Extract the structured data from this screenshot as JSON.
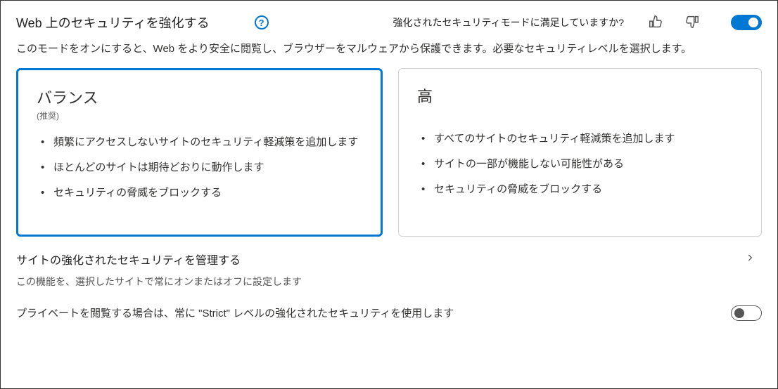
{
  "header": {
    "title": "Web 上のセキュリティを強化する",
    "help_icon_label": "?",
    "feedback_prompt": "強化されたセキュリティモードに満足していますか?",
    "main_toggle_on": true
  },
  "description": "このモードをオンにすると、Web をより安全に閲覧し、ブラウザーをマルウェアから保護できます。必要なセキュリティレベルを選択します。",
  "cards": {
    "balanced": {
      "title": "バランス",
      "subtitle": "(推奨)",
      "items": [
        "頻繁にアクセスしないサイトのセキュリティ軽減策を追加します",
        "ほとんどのサイトは期待どおりに動作します",
        "セキュリティの脅威をブロックする"
      ]
    },
    "strict": {
      "title": "高",
      "items": [
        "すべてのサイトのセキュリティ軽減策を追加します",
        "サイトの一部が機能しない可能性がある",
        "セキュリティの脅威をブロックする"
      ]
    }
  },
  "manage": {
    "title": "サイトの強化されたセキュリティを管理する",
    "desc": "この機能を、選択したサイトで常にオンまたはオフに設定します"
  },
  "private_row": {
    "text": "プライベートを閲覧する場合は、常に \"Strict\" レベルの強化されたセキュリティを使用します",
    "toggle_on": false
  }
}
